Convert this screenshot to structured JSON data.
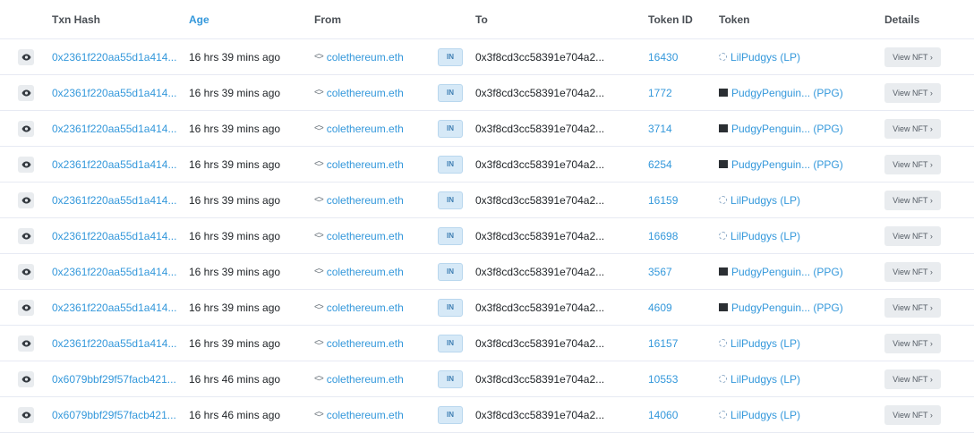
{
  "headers": {
    "hash": "Txn Hash",
    "age": "Age",
    "from": "From",
    "to": "To",
    "token_id": "Token ID",
    "token": "Token",
    "details": "Details"
  },
  "view_label": "View NFT ›",
  "direction": "IN",
  "colors": {
    "link": "#3498db",
    "badge_bg": "#d6e9f7",
    "button_bg": "#e9ecef"
  },
  "rows": [
    {
      "hash": "0x2361f220aa55d1a414...",
      "age": "16 hrs 39 mins ago",
      "from": "colethereum.eth",
      "to": "0x3f8cd3cc58391e704a2...",
      "token_id": "16430",
      "token": "LilPudgys (LP)",
      "token_icon": "lp"
    },
    {
      "hash": "0x2361f220aa55d1a414...",
      "age": "16 hrs 39 mins ago",
      "from": "colethereum.eth",
      "to": "0x3f8cd3cc58391e704a2...",
      "token_id": "1772",
      "token": "PudgyPenguin... (PPG)",
      "token_icon": "ppg"
    },
    {
      "hash": "0x2361f220aa55d1a414...",
      "age": "16 hrs 39 mins ago",
      "from": "colethereum.eth",
      "to": "0x3f8cd3cc58391e704a2...",
      "token_id": "3714",
      "token": "PudgyPenguin... (PPG)",
      "token_icon": "ppg"
    },
    {
      "hash": "0x2361f220aa55d1a414...",
      "age": "16 hrs 39 mins ago",
      "from": "colethereum.eth",
      "to": "0x3f8cd3cc58391e704a2...",
      "token_id": "6254",
      "token": "PudgyPenguin... (PPG)",
      "token_icon": "ppg"
    },
    {
      "hash": "0x2361f220aa55d1a414...",
      "age": "16 hrs 39 mins ago",
      "from": "colethereum.eth",
      "to": "0x3f8cd3cc58391e704a2...",
      "token_id": "16159",
      "token": "LilPudgys (LP)",
      "token_icon": "lp"
    },
    {
      "hash": "0x2361f220aa55d1a414...",
      "age": "16 hrs 39 mins ago",
      "from": "colethereum.eth",
      "to": "0x3f8cd3cc58391e704a2...",
      "token_id": "16698",
      "token": "LilPudgys (LP)",
      "token_icon": "lp"
    },
    {
      "hash": "0x2361f220aa55d1a414...",
      "age": "16 hrs 39 mins ago",
      "from": "colethereum.eth",
      "to": "0x3f8cd3cc58391e704a2...",
      "token_id": "3567",
      "token": "PudgyPenguin... (PPG)",
      "token_icon": "ppg"
    },
    {
      "hash": "0x2361f220aa55d1a414...",
      "age": "16 hrs 39 mins ago",
      "from": "colethereum.eth",
      "to": "0x3f8cd3cc58391e704a2...",
      "token_id": "4609",
      "token": "PudgyPenguin... (PPG)",
      "token_icon": "ppg"
    },
    {
      "hash": "0x2361f220aa55d1a414...",
      "age": "16 hrs 39 mins ago",
      "from": "colethereum.eth",
      "to": "0x3f8cd3cc58391e704a2...",
      "token_id": "16157",
      "token": "LilPudgys (LP)",
      "token_icon": "lp"
    },
    {
      "hash": "0x6079bbf29f57facb421...",
      "age": "16 hrs 46 mins ago",
      "from": "colethereum.eth",
      "to": "0x3f8cd3cc58391e704a2...",
      "token_id": "10553",
      "token": "LilPudgys (LP)",
      "token_icon": "lp"
    },
    {
      "hash": "0x6079bbf29f57facb421...",
      "age": "16 hrs 46 mins ago",
      "from": "colethereum.eth",
      "to": "0x3f8cd3cc58391e704a2...",
      "token_id": "14060",
      "token": "LilPudgys (LP)",
      "token_icon": "lp"
    }
  ]
}
